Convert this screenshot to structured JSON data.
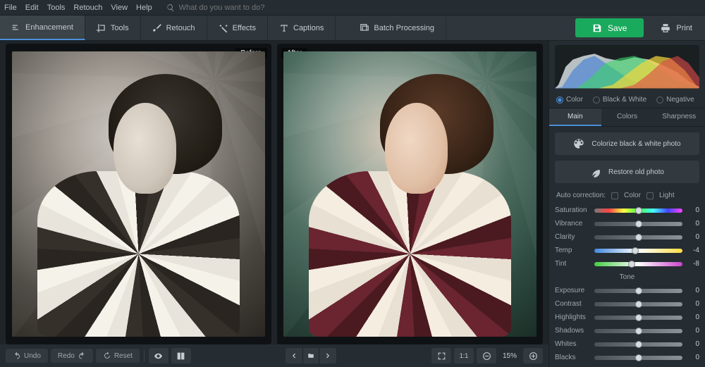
{
  "menu": {
    "file": "File",
    "edit": "Edit",
    "tools": "Tools",
    "retouch": "Retouch",
    "view": "View",
    "help": "Help"
  },
  "search_placeholder": "What do you want to do?",
  "tabs": {
    "enhancement": "Enhancement",
    "tools": "Tools",
    "retouch": "Retouch",
    "effects": "Effects",
    "captions": "Captions",
    "batch": "Batch Processing"
  },
  "actions": {
    "save": "Save",
    "print": "Print"
  },
  "compare": {
    "before": "Before",
    "after": "After"
  },
  "bottom": {
    "undo": "Undo",
    "redo": "Redo",
    "reset": "Reset",
    "zoom": "15%",
    "ratio": "1:1"
  },
  "modes": {
    "color": "Color",
    "bw": "Black & White",
    "negative": "Negative"
  },
  "subtabs": {
    "main": "Main",
    "colors": "Colors",
    "sharpness": "Sharpness"
  },
  "buttons": {
    "colorize": "Colorize black & white photo",
    "restore": "Restore old photo"
  },
  "auto": {
    "label": "Auto correction:",
    "color": "Color",
    "light": "Light"
  },
  "section_tone": "Tone",
  "sliders": [
    {
      "key": "saturation",
      "label": "Saturation",
      "value": 0,
      "track": "sat-track",
      "pos": 50
    },
    {
      "key": "vibrance",
      "label": "Vibrance",
      "value": 0,
      "track": "gray-track",
      "pos": 50
    },
    {
      "key": "clarity",
      "label": "Clarity",
      "value": 0,
      "track": "gray-track",
      "pos": 50
    },
    {
      "key": "temp",
      "label": "Temp",
      "value": -4,
      "track": "temp-track",
      "pos": 46
    },
    {
      "key": "tint",
      "label": "Tint",
      "value": -8,
      "track": "tint-track",
      "pos": 42
    }
  ],
  "tone_sliders": [
    {
      "key": "exposure",
      "label": "Exposure",
      "value": 0,
      "track": "gray-track",
      "pos": 50
    },
    {
      "key": "contrast",
      "label": "Contrast",
      "value": 0,
      "track": "gray-track",
      "pos": 50
    },
    {
      "key": "highlights",
      "label": "Highlights",
      "value": 0,
      "track": "gray-track",
      "pos": 50
    },
    {
      "key": "shadows",
      "label": "Shadows",
      "value": 0,
      "track": "gray-track",
      "pos": 50
    },
    {
      "key": "whites",
      "label": "Whites",
      "value": 0,
      "track": "gray-track",
      "pos": 50
    },
    {
      "key": "blacks",
      "label": "Blacks",
      "value": 0,
      "track": "gray-track",
      "pos": 50
    }
  ]
}
